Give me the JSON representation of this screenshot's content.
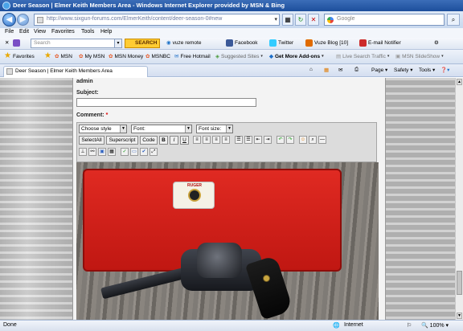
{
  "window": {
    "title": "Deer Season | Elmer Keith Members Area - Windows Internet Explorer provided by MSN & Bing",
    "min": "–",
    "max": "□",
    "close": "✕"
  },
  "address": {
    "url": "http://www.sixgun-forums.com/ElmerKeith/content/deer-season-0#new",
    "search_placeholder": "Google"
  },
  "menu": [
    "File",
    "Edit",
    "View",
    "Favorites",
    "Tools",
    "Help"
  ],
  "toolbar": {
    "search_placeholder": "Search",
    "search_button": "SEARCH",
    "items": [
      "vuze remote",
      "Facebook",
      "Twitter",
      "Vuze Blog [10]",
      "E-mail Notifier"
    ]
  },
  "favorites": {
    "label": "Favorites",
    "items": [
      "MSN",
      "My MSN",
      "MSN Money",
      "MSNBC",
      "Free Hotmail",
      "Suggested Sites",
      "Get More Add-ons",
      "Live Search Traffic",
      "MSN SlideShow"
    ]
  },
  "tab": {
    "label": "Deer Season | Elmer Keith Members Area"
  },
  "commands": [
    "Page",
    "Safety",
    "Tools"
  ],
  "form": {
    "author": "admin",
    "subject_label": "Subject:",
    "subject_value": "",
    "comment_label": "Comment:",
    "required_mark": "*",
    "style_select": "Choose style",
    "font_select": "Font:",
    "size_select": "Font size:",
    "btn_selectall": "SelectAll",
    "btn_superscript": "Superscript",
    "btn_code": "Code",
    "btn_bold": "B",
    "btn_italic": "I",
    "btn_underline": "U"
  },
  "photo": {
    "brand": "RUGER"
  },
  "status": {
    "left": "Done",
    "zone": "Internet",
    "zoom": "100%"
  }
}
